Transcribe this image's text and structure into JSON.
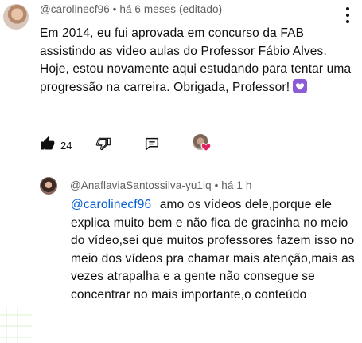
{
  "comment": {
    "author": "@carolinecf96",
    "separator": "•",
    "time": "há 6 meses (editado)",
    "text": "Em 2014, eu fui aprovada em concurso da FAB assistindo as video aulas do Professor Fábio Alves. Hoje, estou novamente aqui estudando para tentar uma progressão na carreira. Obrigada, Professor!",
    "emoji": "purple-heart-icon",
    "like_count": "24",
    "icons": [
      "thumbs-up-icon",
      "thumbs-down-icon",
      "reply-icon",
      "creator-heart-icon",
      "more-vert-icon"
    ]
  },
  "reply": {
    "author": "@AnaflaviaSantossilva-yu1iq",
    "separator": "•",
    "time": "há 1 h",
    "mention": "@carolinecf96",
    "text": "amo os vídeos dele,porque ele explica muito bem e não fica de gracinha no meio do vídeo,sei que muitos professores fazem isso no meio dos vídeos pra chamar mais atenção,mais as vezes atrapalha e a gente não consegue se concentrar no mais importante,o conteúdo"
  },
  "colors": {
    "text": "#0f0f0f",
    "meta": "#606060",
    "mention": "#065fd4",
    "emoji_bg": "#8b5cd6",
    "heart": "#e0245e"
  }
}
